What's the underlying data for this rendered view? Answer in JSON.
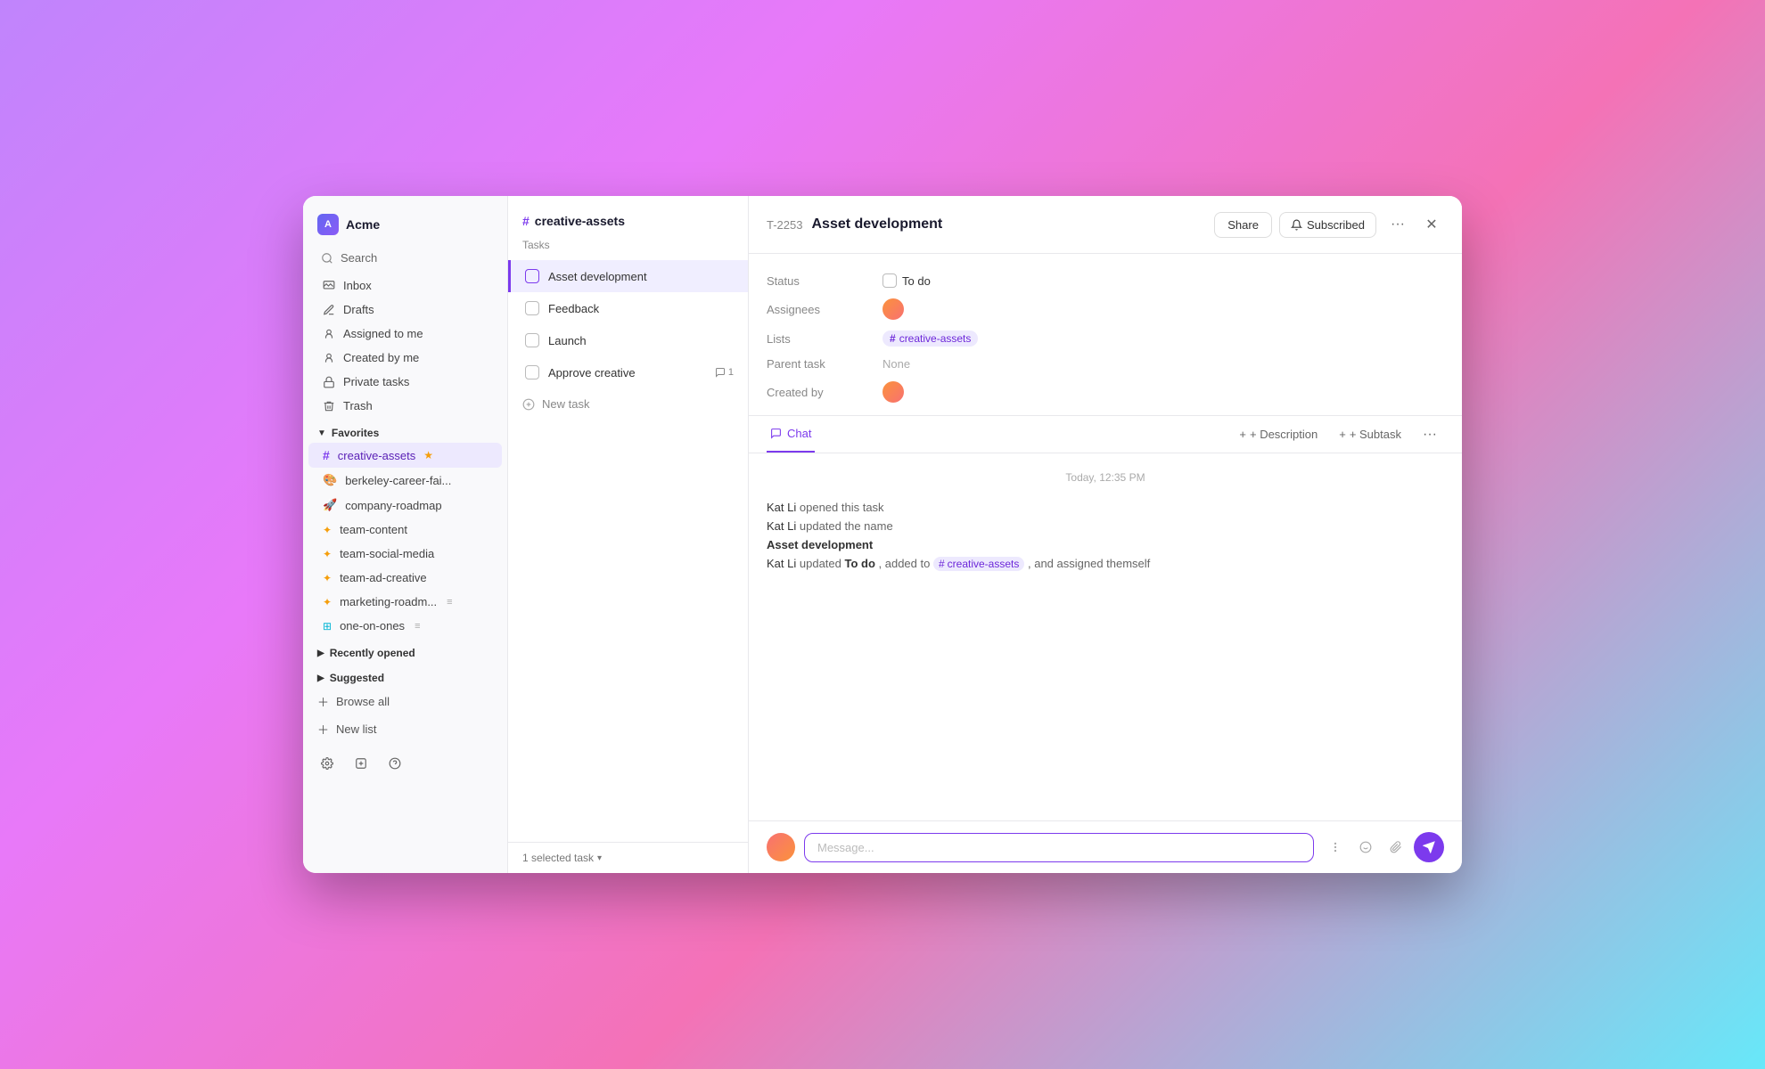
{
  "window": {
    "title": "Asset development"
  },
  "sidebar": {
    "workspace_name": "Acme",
    "workspace_initial": "A",
    "search_placeholder": "Search",
    "nav_items": [
      {
        "id": "inbox",
        "label": "Inbox",
        "icon": "inbox"
      },
      {
        "id": "drafts",
        "label": "Drafts",
        "icon": "drafts"
      },
      {
        "id": "assigned",
        "label": "Assigned to me",
        "icon": "assigned"
      },
      {
        "id": "created",
        "label": "Created by me",
        "icon": "created"
      },
      {
        "id": "private",
        "label": "Private tasks",
        "icon": "private"
      },
      {
        "id": "trash",
        "label": "Trash",
        "icon": "trash"
      }
    ],
    "favorites_label": "Favorites",
    "favorites": [
      {
        "id": "creative-assets",
        "label": "creative-assets",
        "active": true
      },
      {
        "id": "berkeley",
        "label": "berkeley-career-fai...",
        "icon": "paint"
      },
      {
        "id": "roadmap",
        "label": "company-roadmap",
        "icon": "rocket"
      },
      {
        "id": "team-content",
        "label": "team-content",
        "icon": "star4"
      },
      {
        "id": "team-social",
        "label": "team-social-media",
        "icon": "star4"
      },
      {
        "id": "team-ad",
        "label": "team-ad-creative",
        "icon": "star4"
      },
      {
        "id": "marketing",
        "label": "marketing-roadm...",
        "icon": "star4"
      },
      {
        "id": "one-on-ones",
        "label": "one-on-ones",
        "icon": "grid"
      }
    ],
    "recently_opened_label": "Recently opened",
    "suggested_label": "Suggested",
    "browse_all_label": "Browse all",
    "new_list_label": "New list"
  },
  "task_list": {
    "list_name": "creative-assets",
    "section_label": "Tasks",
    "tasks": [
      {
        "id": "t1",
        "label": "Asset development",
        "selected": true,
        "comments": 0
      },
      {
        "id": "t2",
        "label": "Feedback",
        "selected": false,
        "comments": 0
      },
      {
        "id": "t3",
        "label": "Launch",
        "selected": false,
        "comments": 0
      },
      {
        "id": "t4",
        "label": "Approve creative",
        "selected": false,
        "comments": 1
      }
    ],
    "new_task_label": "New task",
    "footer_label": "1 selected task"
  },
  "detail": {
    "task_id": "T-2253",
    "task_title": "Asset development",
    "share_label": "Share",
    "subscribed_label": "Subscribed",
    "fields": {
      "status_label": "Status",
      "status_value": "To do",
      "assignees_label": "Assignees",
      "lists_label": "Lists",
      "list_value": "creative-assets",
      "parent_label": "Parent task",
      "parent_value": "None",
      "created_label": "Created by"
    },
    "chat_tab": "Chat",
    "description_label": "+ Description",
    "subtask_label": "+ Subtask",
    "timestamp": "Today, 12:35 PM",
    "activities": [
      {
        "text": "Kat Li opened this task",
        "actor": "Kat Li",
        "action": "opened this task"
      },
      {
        "text": "Kat Li updated the name",
        "actor": "Kat Li",
        "action": "updated the name"
      },
      {
        "name_update": "Asset development"
      },
      {
        "text": "Kat Li updated  To do , added to  # creative-assets , and assigned themself",
        "actor": "Kat Li",
        "action": "updated",
        "bold": "To do",
        "tag": "creative-assets",
        "suffix": ", and assigned themself"
      }
    ],
    "message_placeholder": "Message..."
  }
}
